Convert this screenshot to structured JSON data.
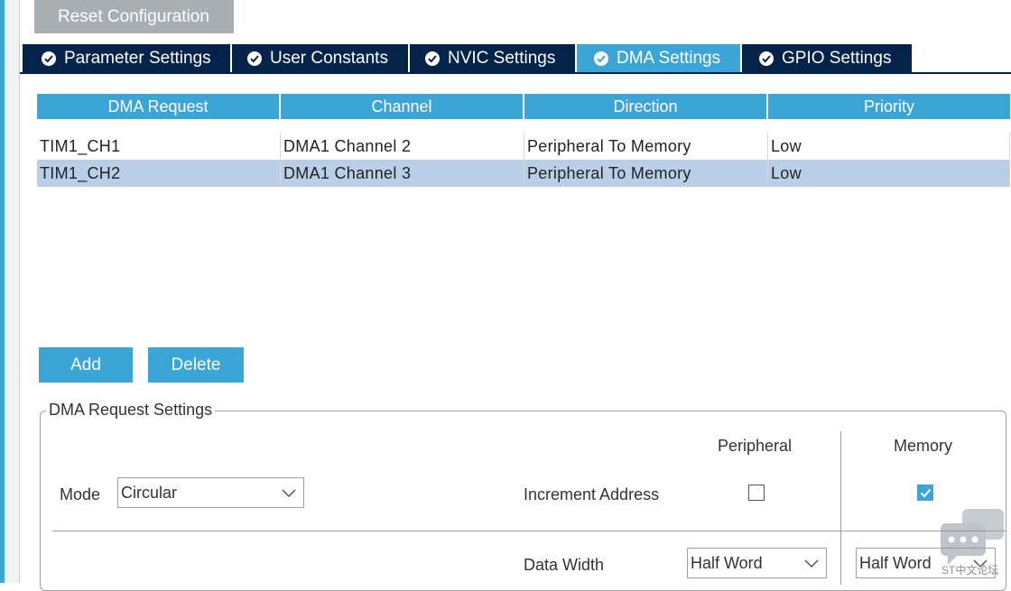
{
  "reset_button": "Reset Configuration",
  "tabs": [
    {
      "label": "Parameter Settings",
      "active": false
    },
    {
      "label": "User Constants",
      "active": false
    },
    {
      "label": "NVIC Settings",
      "active": false
    },
    {
      "label": "DMA Settings",
      "active": true
    },
    {
      "label": "GPIO Settings",
      "active": false
    }
  ],
  "table": {
    "headers": [
      "DMA Request",
      "Channel",
      "Direction",
      "Priority"
    ],
    "rows": [
      [
        "TIM1_CH1",
        "DMA1 Channel 2",
        "Peripheral To Memory",
        "Low"
      ],
      [
        "TIM1_CH2",
        "DMA1 Channel 3",
        "Peripheral To Memory",
        "Low"
      ]
    ],
    "selected_row": 1
  },
  "buttons": {
    "add": "Add",
    "delete": "Delete"
  },
  "settings": {
    "title": "DMA Request Settings",
    "mode_label": "Mode",
    "mode_value": "Circular",
    "peripheral_header": "Peripheral",
    "memory_header": "Memory",
    "increment_label": "Increment Address",
    "increment_peripheral": false,
    "increment_memory": true,
    "data_width_label": "Data Width",
    "data_width_peripheral": "Half Word",
    "data_width_memory": "Half Word"
  },
  "watermark": "ST中文论坛",
  "colors": {
    "accent": "#3ba5d8",
    "navy": "#03234b",
    "selected_row": "#b8cfe7"
  }
}
